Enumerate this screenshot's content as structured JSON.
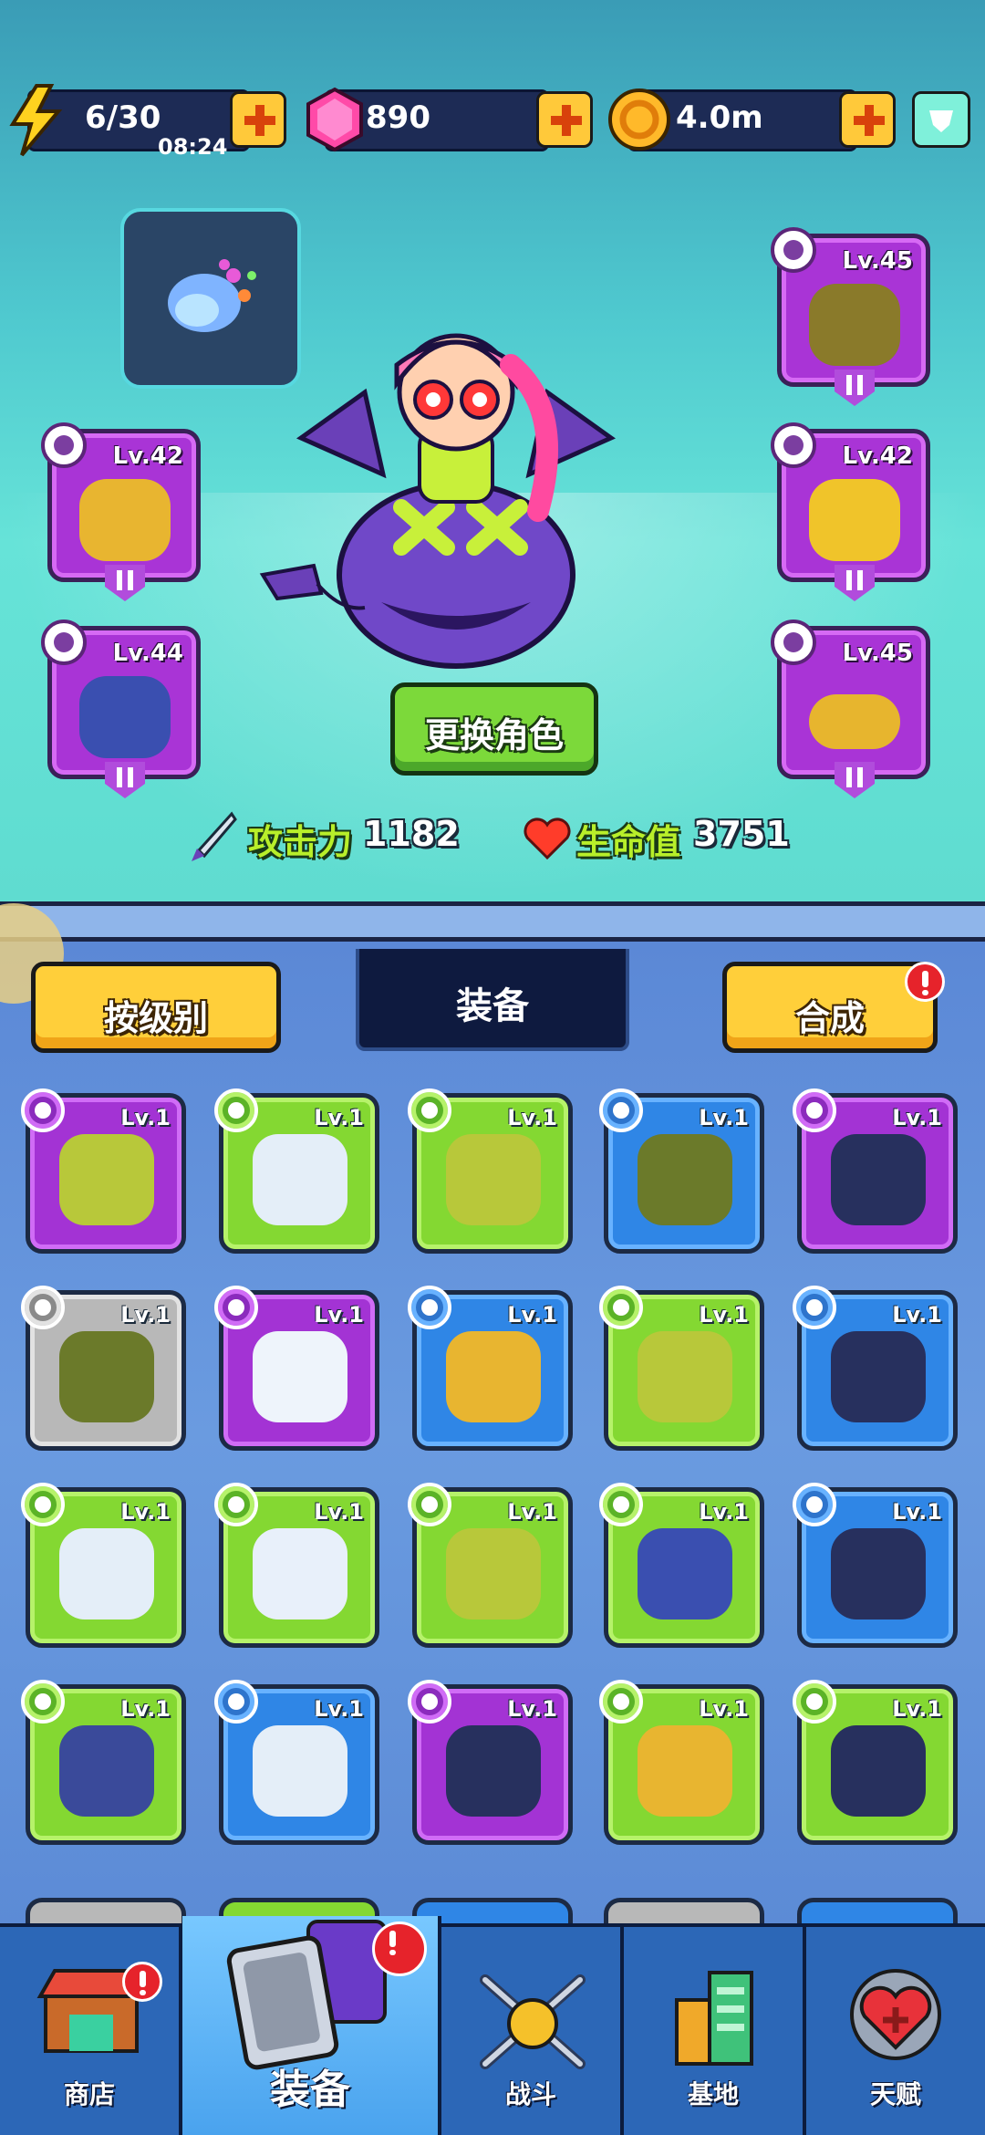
{
  "resources": {
    "energy": {
      "value": "6/30",
      "timer": "08:24",
      "icon": "lightning-icon"
    },
    "gems": {
      "value": "890",
      "icon": "gem-icon"
    },
    "coins": {
      "value": "4.0m",
      "icon": "coin-icon"
    }
  },
  "equipped": {
    "left": [
      {
        "name": "scarf-slot",
        "level": "Lv.42"
      },
      {
        "name": "gauntlet-slot",
        "level": "Lv.44"
      }
    ],
    "right": [
      {
        "name": "armor-slot",
        "level": "Lv.45"
      },
      {
        "name": "pants-slot",
        "level": "Lv.42"
      },
      {
        "name": "shoes-slot",
        "level": "Lv.45"
      }
    ]
  },
  "change_character_label": "更换角色",
  "stats": {
    "attack_label": "攻击力",
    "attack_value": "1182",
    "hp_label": "生命值",
    "hp_value": "3751"
  },
  "controls": {
    "sort_label": "按级别",
    "tab_label": "装备",
    "merge_label": "合成"
  },
  "inventory": [
    {
      "rarity": "purple",
      "level": "Lv.1",
      "item": "pants"
    },
    {
      "rarity": "green",
      "level": "Lv.1",
      "item": "glove"
    },
    {
      "rarity": "green",
      "level": "Lv.1",
      "item": "pants"
    },
    {
      "rarity": "blue",
      "level": "Lv.1",
      "item": "boots"
    },
    {
      "rarity": "purple",
      "level": "Lv.1",
      "item": "necklace"
    },
    {
      "rarity": "gray",
      "level": "Lv.1",
      "item": "boots"
    },
    {
      "rarity": "purple",
      "level": "Lv.1",
      "item": "sock"
    },
    {
      "rarity": "blue",
      "level": "Lv.1",
      "item": "scarf"
    },
    {
      "rarity": "green",
      "level": "Lv.1",
      "item": "pants"
    },
    {
      "rarity": "blue",
      "level": "Lv.1",
      "item": "necklace"
    },
    {
      "rarity": "green",
      "level": "Lv.1",
      "item": "glove"
    },
    {
      "rarity": "green",
      "level": "Lv.1",
      "item": "vest"
    },
    {
      "rarity": "green",
      "level": "Lv.1",
      "item": "pants"
    },
    {
      "rarity": "green",
      "level": "Lv.1",
      "item": "gauntlet"
    },
    {
      "rarity": "blue",
      "level": "Lv.1",
      "item": "necklace"
    },
    {
      "rarity": "green",
      "level": "Lv.1",
      "item": "armor"
    },
    {
      "rarity": "blue",
      "level": "Lv.1",
      "item": "glove"
    },
    {
      "rarity": "purple",
      "level": "Lv.1",
      "item": "necklace"
    },
    {
      "rarity": "green",
      "level": "Lv.1",
      "item": "scarf"
    },
    {
      "rarity": "green",
      "level": "Lv.1",
      "item": "necklace"
    }
  ],
  "nav": [
    {
      "label": "商店",
      "icon": "shop-icon"
    },
    {
      "label": "装备",
      "icon": "cards-icon"
    },
    {
      "label": "战斗",
      "icon": "battle-icon"
    },
    {
      "label": "基地",
      "icon": "base-icon"
    },
    {
      "label": "天赋",
      "icon": "talent-icon"
    }
  ]
}
